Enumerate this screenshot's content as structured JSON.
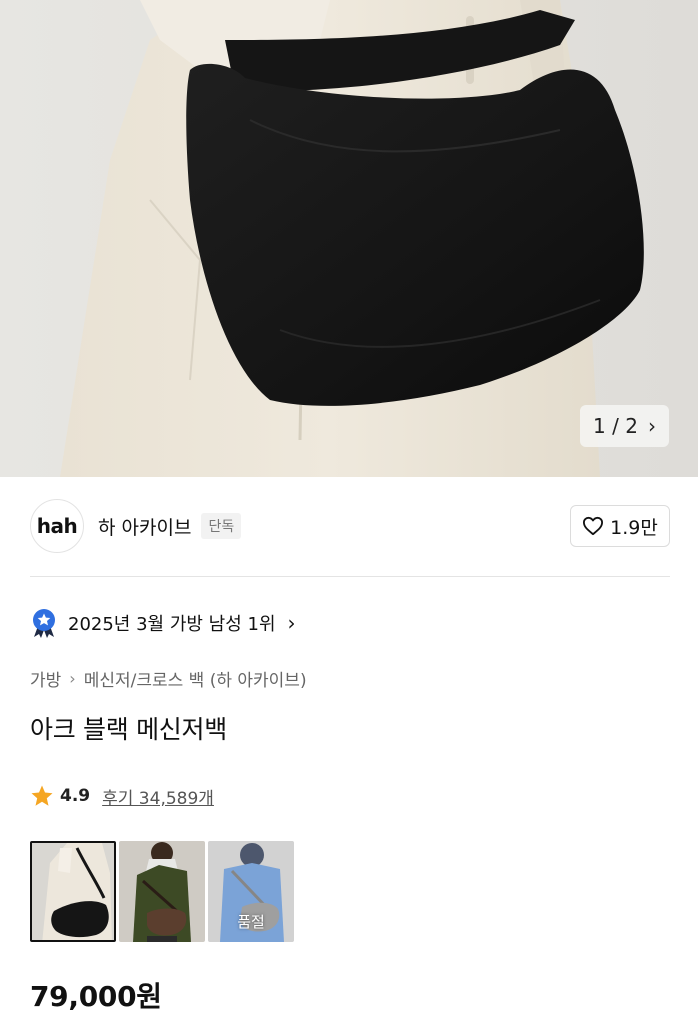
{
  "hero": {
    "pager_current": "1",
    "pager_total": "2",
    "pager_text": "1 / 2"
  },
  "brand": {
    "logo_text": "hah",
    "name": "하 아카이브",
    "tag": "단독",
    "like_count": "1.9만"
  },
  "ranking": {
    "text": "2025년 3월 가방 남성 1위"
  },
  "breadcrumb": {
    "level1": "가방",
    "level2": "메신저/크로스 백 (하 아카이브)"
  },
  "product": {
    "title": "아크 블랙 메신저백",
    "rating": "4.9",
    "reviews": "후기 34,589개",
    "price": "79,000원"
  },
  "options": [
    {
      "name": "black",
      "selected": true,
      "status": ""
    },
    {
      "name": "brown",
      "selected": false,
      "status": ""
    },
    {
      "name": "gray",
      "selected": false,
      "status": "품절"
    }
  ],
  "colors": {
    "star": "#f5a623",
    "badge_blue": "#2f6fe0"
  }
}
